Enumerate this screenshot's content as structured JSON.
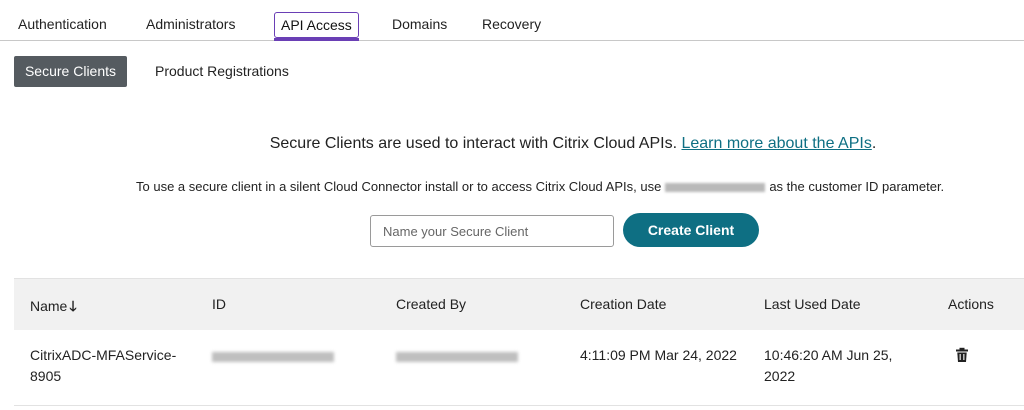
{
  "tabs": [
    {
      "label": "Authentication"
    },
    {
      "label": "Administrators"
    },
    {
      "label": "API Access"
    },
    {
      "label": "Domains"
    },
    {
      "label": "Recovery"
    }
  ],
  "subtabs": {
    "secure_clients": "Secure Clients",
    "product_registrations": "Product Registrations"
  },
  "intro": {
    "text": "Secure Clients are used to interact with Citrix Cloud APIs. ",
    "link": "Learn more about the APIs",
    "suffix": "."
  },
  "subline": {
    "before": "To use a secure client in a silent Cloud Connector install or to access Citrix Cloud APIs, use",
    "after": "as the customer ID parameter."
  },
  "create": {
    "placeholder": "Name your Secure Client",
    "button": "Create Client"
  },
  "table": {
    "headers": {
      "name": "Name",
      "sort_icon": "arrow-down-icon",
      "id": "ID",
      "created_by": "Created By",
      "creation_date": "Creation Date",
      "last_used": "Last Used Date",
      "actions": "Actions"
    },
    "rows": [
      {
        "name": "CitrixADC-MFAService-8905",
        "creation_date": "4:11:09 PM Mar 24, 2022",
        "last_used": "10:46:20 AM Jun 25, 2022",
        "action_icon": "trash-icon"
      }
    ]
  },
  "colors": {
    "accent": "#0e6f83",
    "tab_highlight": "#6a3fb5",
    "active_subtab": "#555b60"
  }
}
